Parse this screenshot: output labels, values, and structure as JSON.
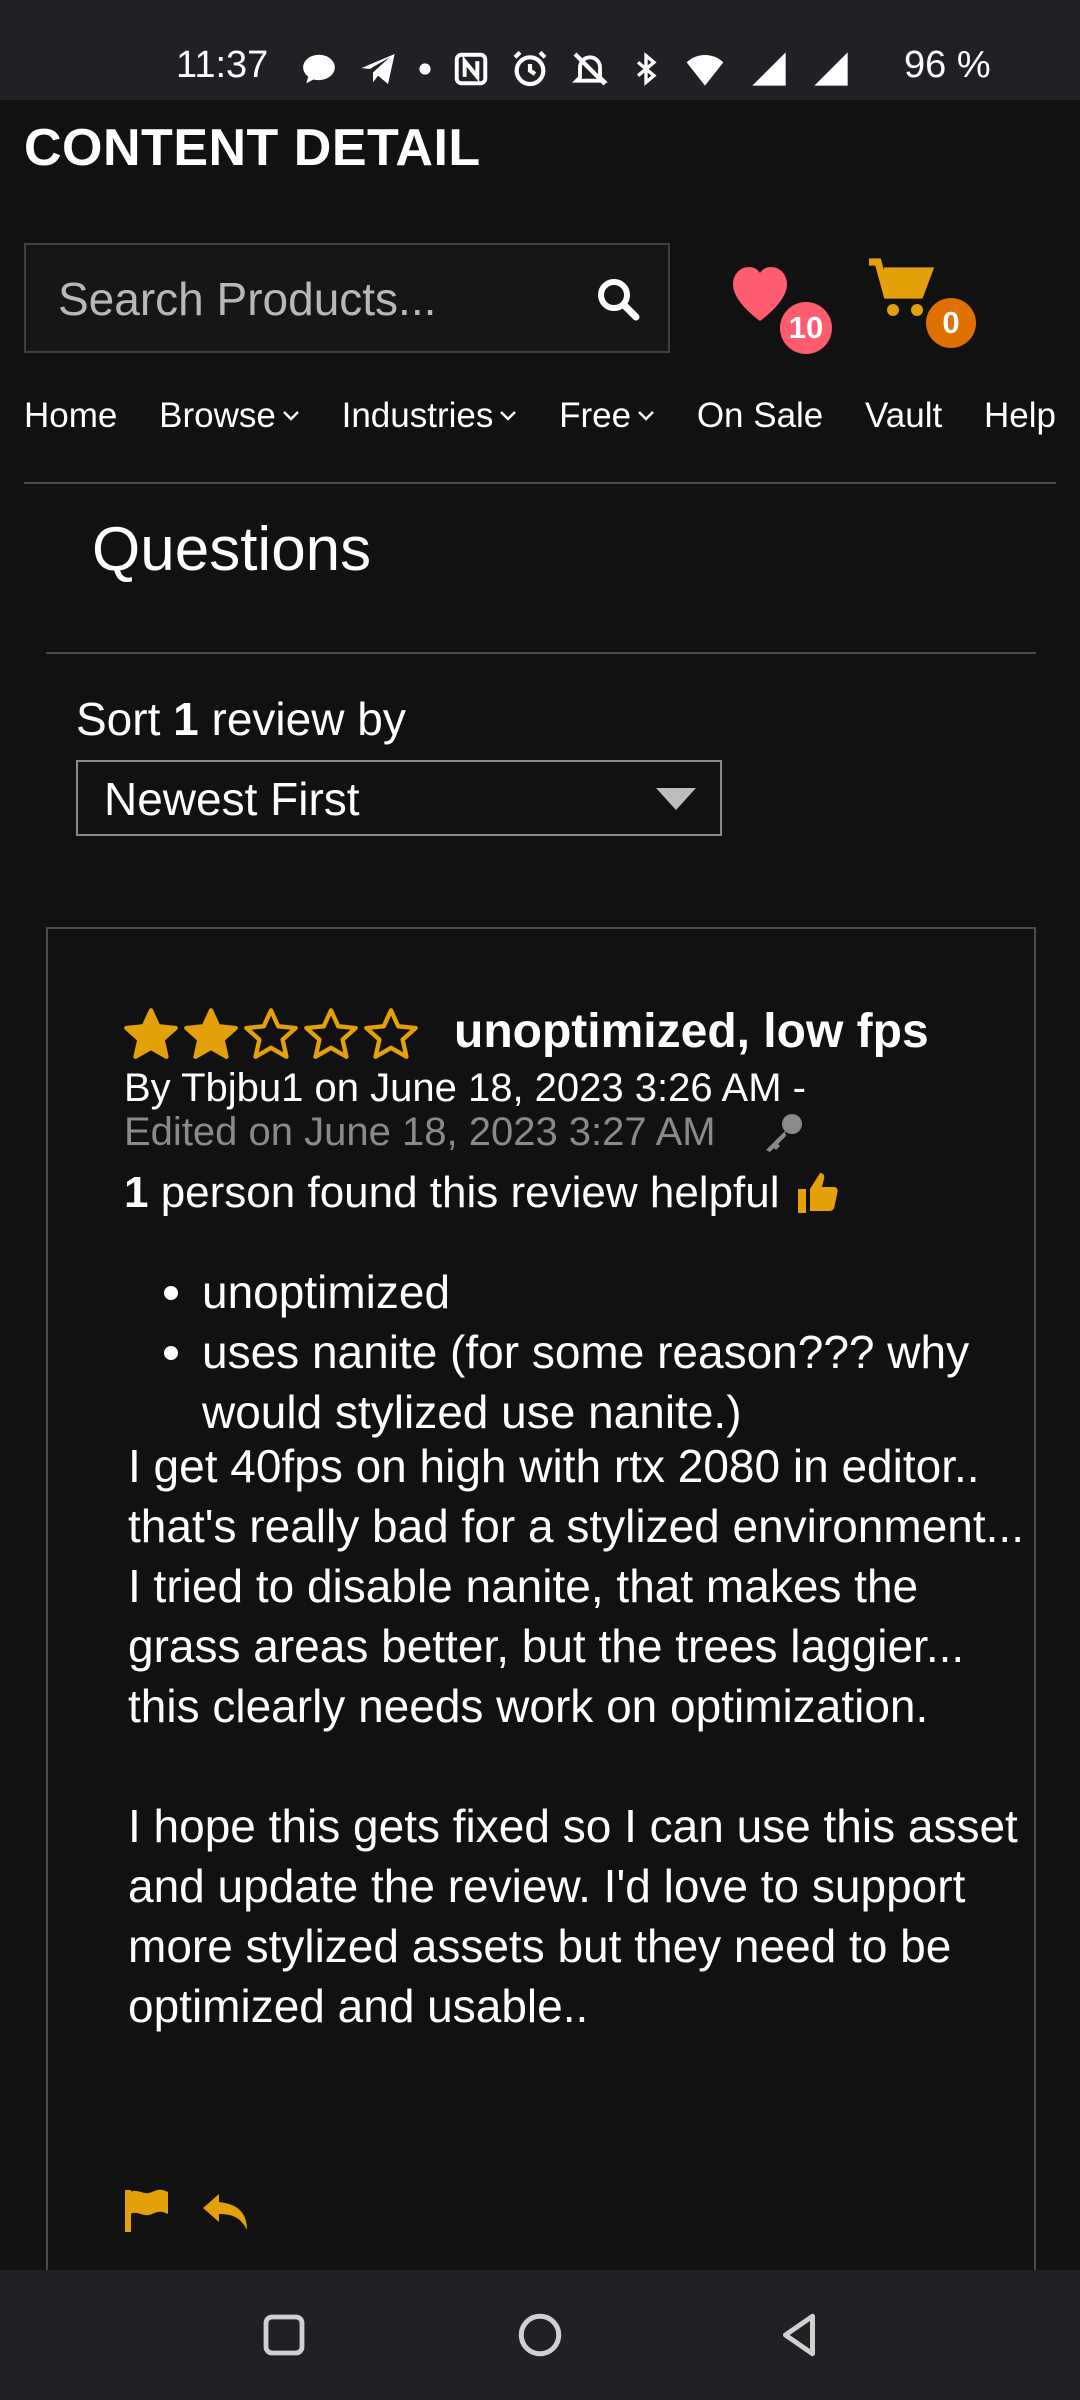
{
  "status_bar": {
    "time": "11:37",
    "battery": "96 %"
  },
  "header": {
    "title": "CONTENT DETAIL",
    "search_placeholder": "Search Products...",
    "wishlist_count": "10",
    "cart_count": "0"
  },
  "nav": {
    "items": [
      {
        "label": "Home",
        "dropdown": false
      },
      {
        "label": "Browse",
        "dropdown": true
      },
      {
        "label": "Industries",
        "dropdown": true
      },
      {
        "label": "Free",
        "dropdown": true
      },
      {
        "label": "On Sale",
        "dropdown": false
      },
      {
        "label": "Vault",
        "dropdown": false
      },
      {
        "label": "Help",
        "dropdown": false
      }
    ]
  },
  "section": {
    "title": "Questions"
  },
  "sort": {
    "prefix": "Sort ",
    "count": "1",
    "suffix": " review by",
    "selected": "Newest First"
  },
  "review": {
    "rating": 2,
    "max_rating": 5,
    "title": "unoptimized, low fps",
    "by_line": "By Tbjbu1 on June 18, 2023 3:26 AM -",
    "edited_line": "Edited on June 18, 2023 3:27 AM",
    "helpful_count": "1",
    "helpful_text": " person found this review helpful",
    "bullets": [
      "unoptimized",
      "uses nanite (for some reason??? why would stylized use nanite.)"
    ],
    "body": "I get 40fps on high with rtx 2080 in editor.. that's really bad for a stylized environment... I tried to disable nanite, that makes the grass areas better, but the trees laggier...\nthis clearly needs work on optimization.\n\nI hope this gets fixed so I can use this asset and update the review. I'd love to support more stylized assets but they need to be optimized and usable.."
  },
  "colors": {
    "accent_gold": "#e3a008",
    "heart_pink": "#ff5c70",
    "cart_badge": "#e07000",
    "background": "#111111"
  }
}
